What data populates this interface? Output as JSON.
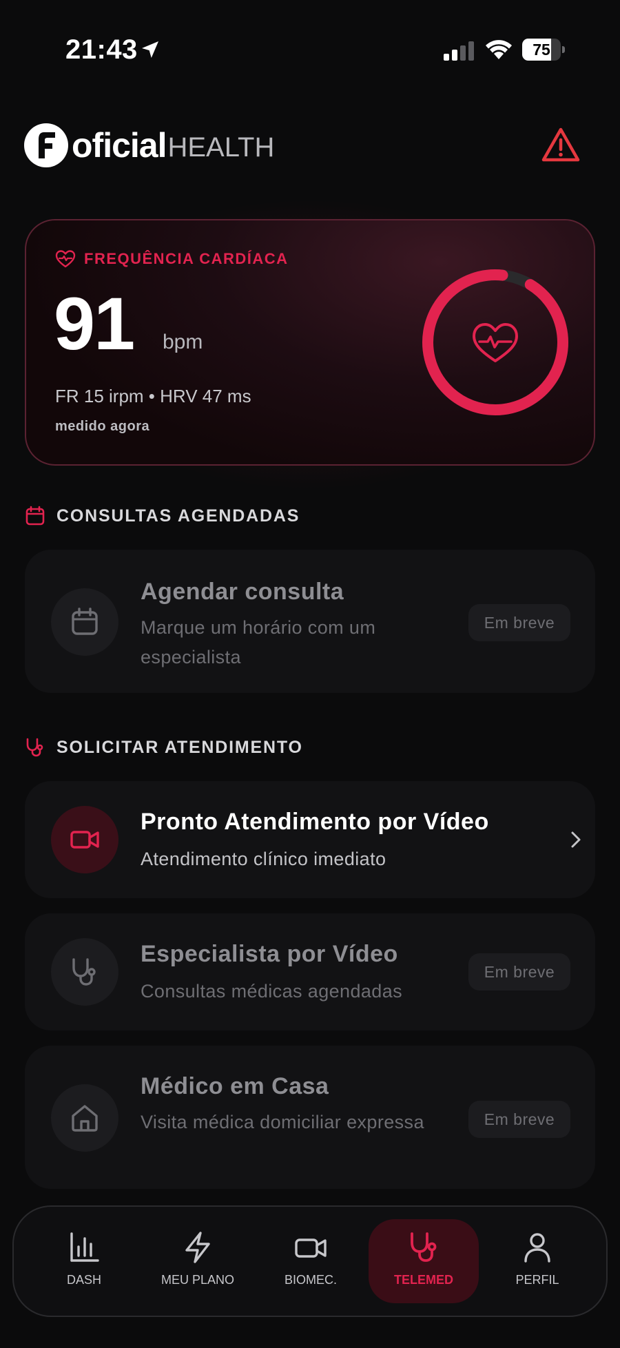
{
  "status_bar": {
    "time": "21:43",
    "battery": "75",
    "battery_level": 0.75
  },
  "header": {
    "logo_part1": "oficial",
    "logo_part2": "HEALTH"
  },
  "heart_card": {
    "label": "FREQUÊNCIA CARDÍACA",
    "value": "91",
    "unit": "bpm",
    "sub": "FR 15 irpm • HRV 47 ms",
    "measured": "medido agora",
    "ring_fraction": 0.93
  },
  "section_consultas": {
    "title": "CONSULTAS AGENDADAS"
  },
  "card_agendar": {
    "title": "Agendar consulta",
    "desc": "Marque um horário com um especialista",
    "badge": "Em breve"
  },
  "section_atendimento": {
    "title": "SOLICITAR ATENDIMENTO"
  },
  "card_pronto": {
    "title": "Pronto Atendimento por Vídeo",
    "desc": "Atendimento clínico imediato"
  },
  "card_especialista": {
    "title": "Especialista por Vídeo",
    "desc": "Consultas médicas agendadas",
    "badge": "Em breve"
  },
  "card_casa": {
    "title": "Médico em Casa",
    "desc": "Visita médica domiciliar expressa",
    "badge": "Em breve"
  },
  "bottom_nav": {
    "items": [
      {
        "label": "DASH"
      },
      {
        "label": "MEU PLANO"
      },
      {
        "label": "BIOMEC."
      },
      {
        "label": "TELEMED"
      },
      {
        "label": "PERFIL"
      }
    ]
  },
  "colors": {
    "accent": "#e2234f",
    "background": "#0b0b0c",
    "card": "#121214"
  }
}
